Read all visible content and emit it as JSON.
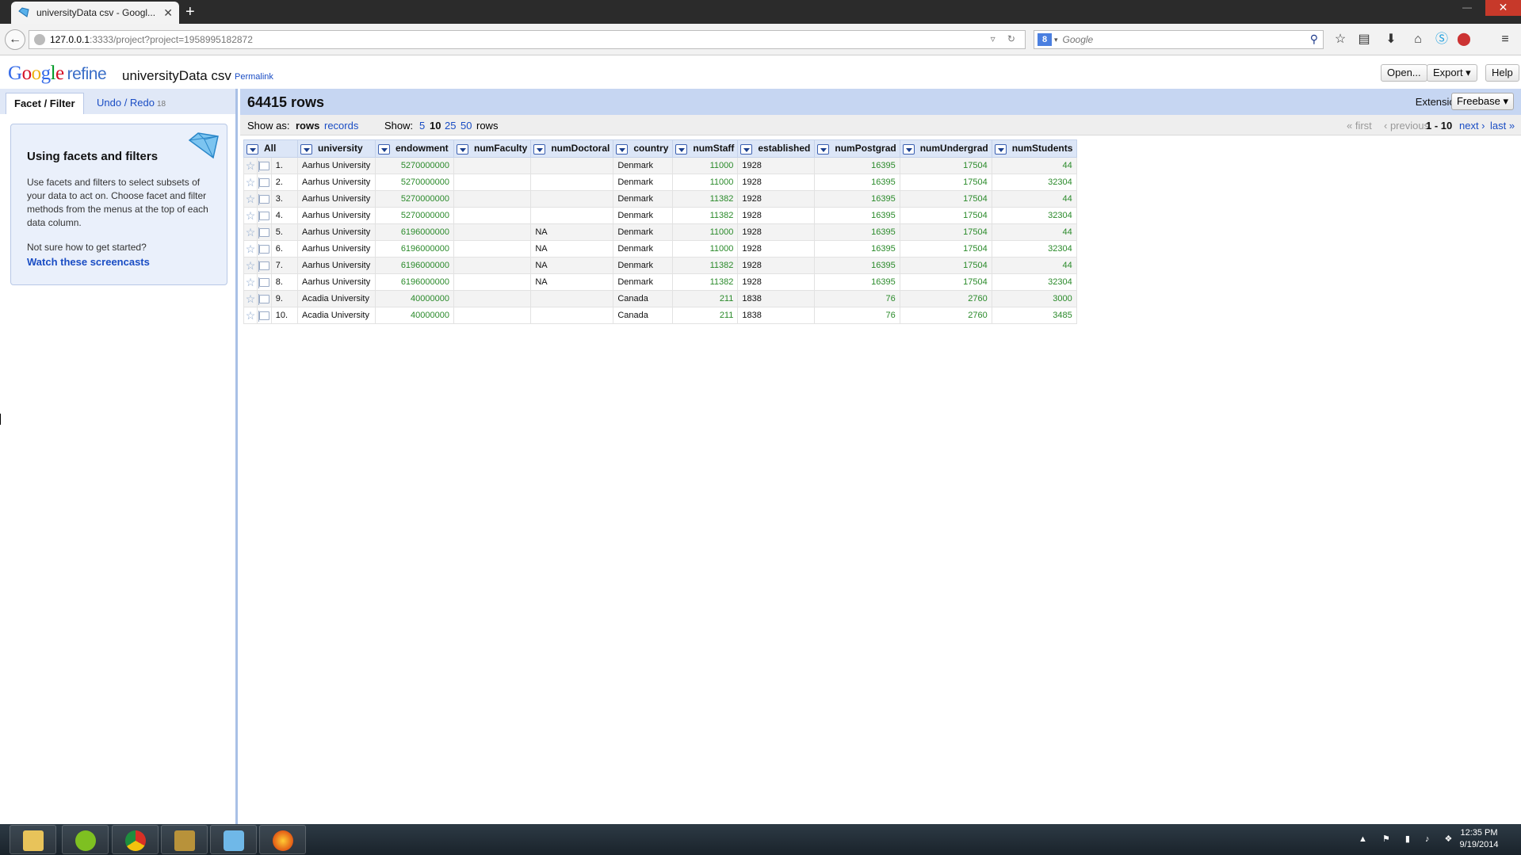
{
  "browser": {
    "tab_title": "universityData csv - Googl...",
    "url_host": "127.0.0.1",
    "url_rest": ":3333/project?project=1958995182872",
    "search_placeholder": "Google"
  },
  "app": {
    "logo_google": [
      "G",
      "o",
      "o",
      "g",
      "l",
      "e"
    ],
    "logo_refine": "refine",
    "project_name": "universityData csv",
    "permalink": "Permalink",
    "buttons": {
      "open": "Open...",
      "export": "Export ▾",
      "help": "Help"
    }
  },
  "left_panel": {
    "tabs": {
      "facet": "Facet / Filter",
      "undo": "Undo / Redo",
      "undo_count": "18"
    },
    "help": {
      "title": "Using facets and filters",
      "body": "Use facets and filters to select subsets of your data to act on. Choose facet and filter methods from the menus at the top of each data column.",
      "prompt": "Not sure how to get started?",
      "link": "Watch these screencasts"
    }
  },
  "data_view": {
    "row_count": "64415 rows",
    "extensions_label": "Extensions:",
    "extensions_button": "Freebase ▾",
    "show_as_label": "Show as:",
    "show_as_rows": "rows",
    "show_as_records": "records",
    "show_label": "Show:",
    "page_sizes": [
      "5",
      "10",
      "25",
      "50"
    ],
    "page_size_selected": "10",
    "rows_word": "rows",
    "pager": {
      "first": "« first",
      "previous": "‹ previous",
      "range": "1 - 10",
      "next": "next ›",
      "last": "last »"
    },
    "columns": [
      "All",
      "university",
      "endowment",
      "numFaculty",
      "numDoctoral",
      "country",
      "numStaff",
      "established",
      "numPostgrad",
      "numUndergrad",
      "numStudents"
    ],
    "rows": [
      [
        "1.",
        "Aarhus University",
        "5270000000",
        "",
        "",
        "Denmark",
        "11000",
        "1928",
        "16395",
        "17504",
        "44"
      ],
      [
        "2.",
        "Aarhus University",
        "5270000000",
        "",
        "",
        "Denmark",
        "11000",
        "1928",
        "16395",
        "17504",
        "32304"
      ],
      [
        "3.",
        "Aarhus University",
        "5270000000",
        "",
        "",
        "Denmark",
        "11382",
        "1928",
        "16395",
        "17504",
        "44"
      ],
      [
        "4.",
        "Aarhus University",
        "5270000000",
        "",
        "",
        "Denmark",
        "11382",
        "1928",
        "16395",
        "17504",
        "32304"
      ],
      [
        "5.",
        "Aarhus University",
        "6196000000",
        "",
        "NA",
        "Denmark",
        "11000",
        "1928",
        "16395",
        "17504",
        "44"
      ],
      [
        "6.",
        "Aarhus University",
        "6196000000",
        "",
        "NA",
        "Denmark",
        "11000",
        "1928",
        "16395",
        "17504",
        "32304"
      ],
      [
        "7.",
        "Aarhus University",
        "6196000000",
        "",
        "NA",
        "Denmark",
        "11382",
        "1928",
        "16395",
        "17504",
        "44"
      ],
      [
        "8.",
        "Aarhus University",
        "6196000000",
        "",
        "NA",
        "Denmark",
        "11382",
        "1928",
        "16395",
        "17504",
        "32304"
      ],
      [
        "9.",
        "Acadia University",
        "40000000",
        "",
        "",
        "Canada",
        "211",
        "1838",
        "76",
        "2760",
        "3000"
      ],
      [
        "10.",
        "Acadia University",
        "40000000",
        "",
        "",
        "Canada",
        "211",
        "1838",
        "76",
        "2760",
        "3485"
      ]
    ]
  },
  "taskbar": {
    "clock_time": "12:35 PM",
    "clock_date": "9/19/2014"
  }
}
